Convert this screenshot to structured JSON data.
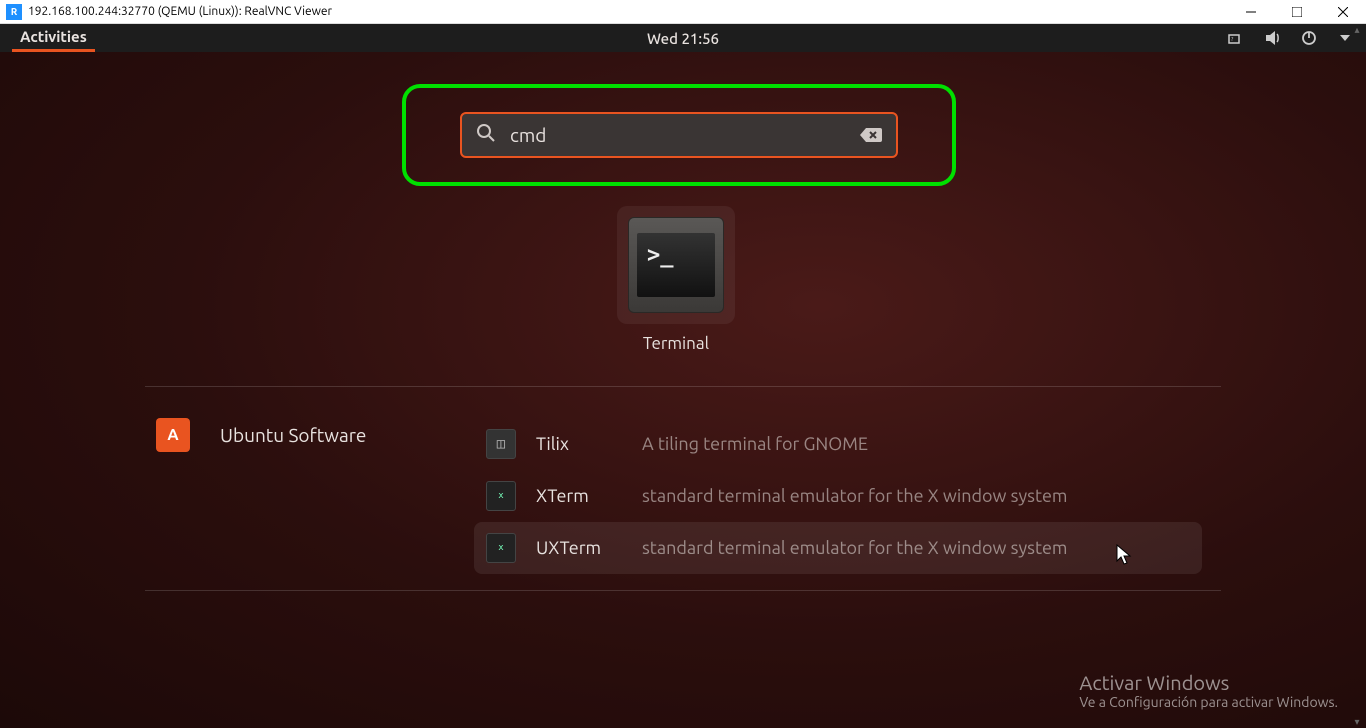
{
  "host": {
    "title": "192.168.100.244:32770 (QEMU (Linux)): RealVNC Viewer",
    "icon_letter": "R"
  },
  "panel": {
    "activities": "Activities",
    "clock": "Wed 21:56"
  },
  "search": {
    "value": "cmd"
  },
  "app_result": {
    "label": "Terminal",
    "prompt": ">_"
  },
  "ubuntu_software": {
    "label": "Ubuntu Software",
    "badge": "A"
  },
  "software_results": [
    {
      "name": "Tilix",
      "desc": "A tiling terminal for GNOME",
      "icon": "◫"
    },
    {
      "name": "XTerm",
      "desc": "standard terminal emulator for the X window system",
      "icon": "x"
    },
    {
      "name": "UXTerm",
      "desc": "standard terminal emulator for the X window system",
      "icon": "x"
    }
  ],
  "watermark": {
    "title": "Activar Windows",
    "sub": "Ve a Configuración para activar Windows."
  }
}
